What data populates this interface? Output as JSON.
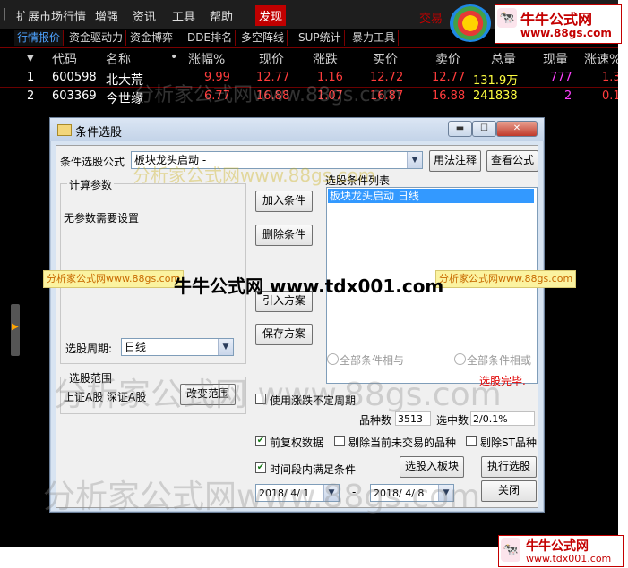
{
  "menu": {
    "items": [
      "扩展市场行情",
      "增强",
      "资讯",
      "工具",
      "帮助",
      "发现"
    ],
    "trade_text": "交易"
  },
  "tabs": [
    "行情报价",
    "资金驱动力",
    "资金博弈",
    "DDE排名",
    "多空阵线",
    "SUP统计",
    "暴力工具"
  ],
  "table": {
    "columns": [
      "代码",
      "名称",
      "•",
      "涨幅%",
      "现价",
      "涨跌",
      "买价",
      "卖价",
      "总量",
      "现量",
      "涨速%"
    ],
    "rows": [
      {
        "idx": "1",
        "code": "600598",
        "name": "北大荒",
        "change_pct": "9.99",
        "price": "12.77",
        "change": "1.16",
        "bid": "12.72",
        "ask": "12.77",
        "volume": "131.9万",
        "cur_vol": "777",
        "speed": "1.3"
      },
      {
        "idx": "2",
        "code": "603369",
        "name": "今世缘",
        "change_pct": "6.77",
        "price": "16.88",
        "change": "1.07",
        "bid": "16.87",
        "ask": "16.88",
        "volume": "241838",
        "cur_vol": "2",
        "speed": "0.1"
      }
    ]
  },
  "dialog": {
    "title": "条件选股",
    "formula_label": "条件选股公式",
    "formula_value": "板块龙头启动 -",
    "usage_btn": "用法注释",
    "view_formula_btn": "查看公式",
    "calc_params_title": "计算参数",
    "no_params": "无参数需要设置",
    "cond_list_title": "选股条件列表",
    "cond_items": [
      "板块龙头启动  日线"
    ],
    "add_btn": "加入条件",
    "delete_btn": "删除条件",
    "import_btn": "引入方案",
    "save_btn": "保存方案",
    "period_label": "选股周期:",
    "period_value": "日线",
    "radio_and": "全部条件相与",
    "radio_or": "全部条件相或",
    "status": "选股完毕.",
    "range_title": "选股范围",
    "range_value": "上证A股 深证A股",
    "change_range_btn": "改变范围",
    "use_period_label": "使用涨跌不定周期",
    "count_label": "品种数",
    "count_value": "3513",
    "selected_label": "选中数",
    "selected_value": "2/0.1%",
    "pre_rights_label": "前复权数据",
    "exclude_untraded_label": "剔除当前未交易的品种",
    "exclude_st_label": "剔除ST品种",
    "time_cond_label": "时间段内满足条件",
    "to_block_btn": "选股入板块",
    "run_btn": "执行选股",
    "date_from": "2018/ 4/ 1",
    "date_sep": "-",
    "date_to": "2018/ 4/ 8",
    "close_btn": "关闭"
  },
  "watermarks": {
    "banner_left": "分析家公式网www.88gs.com",
    "banner_right": "分析家公式网www.88gs.com",
    "center": "牛牛公式网 www.tdx001.com",
    "ghost_1": "分析家公式网www.88gs.com",
    "ghost_2": "分析家公式网www.88gs.com",
    "ghost_3": "分析家公式网 www.88gs.com",
    "ghost_4": "分析家公式网www.88gs.com",
    "logo_top_name": "牛牛公式网",
    "logo_top_url": "www.88gs.com",
    "logo_bottom_name": "牛牛公式网",
    "logo_bottom_url": "www.tdx001.com"
  },
  "colors": {
    "up": "#ff3c3c",
    "text": "#ffffff",
    "accent_tab": "#4ea3ff",
    "menu_active": "#c00000",
    "list_selected": "#3399ff"
  }
}
